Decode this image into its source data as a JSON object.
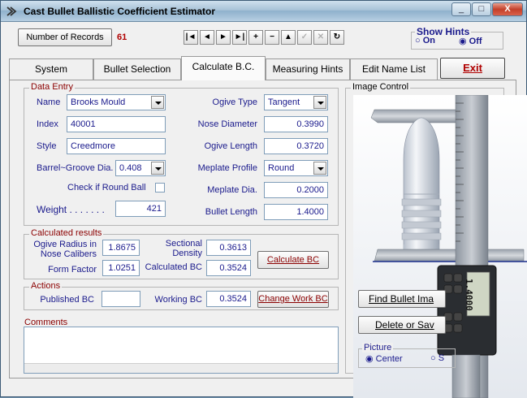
{
  "window": {
    "title": "Cast Bullet Ballistic Coefficient Estimator",
    "controls": [
      "_",
      "□",
      "X"
    ]
  },
  "header": {
    "records_button": "Number of Records",
    "record_count": "61",
    "nav_buttons": [
      "|◄",
      "◄",
      "►",
      "►|",
      "+",
      "−",
      "▲",
      "✓",
      "✕",
      "↻"
    ],
    "hints": {
      "title": "Show Hints",
      "on": "On",
      "off": "Off"
    }
  },
  "tabs": {
    "system": "System",
    "bullet_selection": "Bullet Selection",
    "calculate_bc": "Calculate B.C.",
    "measuring_hints": "Measuring Hints",
    "edit_name_list": "Edit Name List",
    "exit": "Exit"
  },
  "data_entry": {
    "title": "Data Entry",
    "name_label": "Name",
    "name_value": "Brooks Mould",
    "index_label": "Index",
    "index_value": "40001",
    "style_label": "Style",
    "style_value": "Creedmore",
    "barrel_label": "Barrel~Groove Dia.",
    "barrel_value": "0.408",
    "round_ball_label": "Check if Round Ball",
    "weight_label": "Weight . . . . . . .",
    "weight_value": "421",
    "ogive_type_label": "Ogive Type",
    "ogive_type_value": "Tangent",
    "nose_diameter_label": "Nose Diameter",
    "nose_diameter_value": "0.3990",
    "ogive_length_label": "Ogive Length",
    "ogive_length_value": "0.3720",
    "meplate_profile_label": "Meplate Profile",
    "meplate_profile_value": "Round",
    "meplate_dia_label": "Meplate Dia.",
    "meplate_dia_value": "0.2000",
    "bullet_length_label": "Bullet Length",
    "bullet_length_value": "1.4000"
  },
  "calculated": {
    "title": "Calculated results",
    "ogive_radius_label_1": "Ogive Radius in",
    "ogive_radius_label_2": "Nose Calibers",
    "ogive_radius_value": "1.8675",
    "form_factor_label": "Form Factor",
    "form_factor_value": "1.0251",
    "sectional_density_label_1": "Sectional",
    "sectional_density_label_2": "Density",
    "sectional_density_value": "0.3613",
    "calculated_bc_label": "Calculated BC",
    "calculated_bc_value": "0.3524",
    "calculate_button": "Calculate BC"
  },
  "actions": {
    "title": "Actions",
    "published_bc_label": "Published BC",
    "published_bc_value": "",
    "working_bc_label": "Working BC",
    "working_bc_value": "0.3524",
    "change_button": "Change Work BC"
  },
  "comments": {
    "title": "Comments",
    "value": ""
  },
  "image_control": {
    "title": "Image Control",
    "caliper_readout": "1.4000",
    "find_button": "Find Bullet Ima",
    "delete_button": "Delete or Sav",
    "picture_title": "Picture",
    "picture_center": "Center",
    "picture_other": "S"
  }
}
